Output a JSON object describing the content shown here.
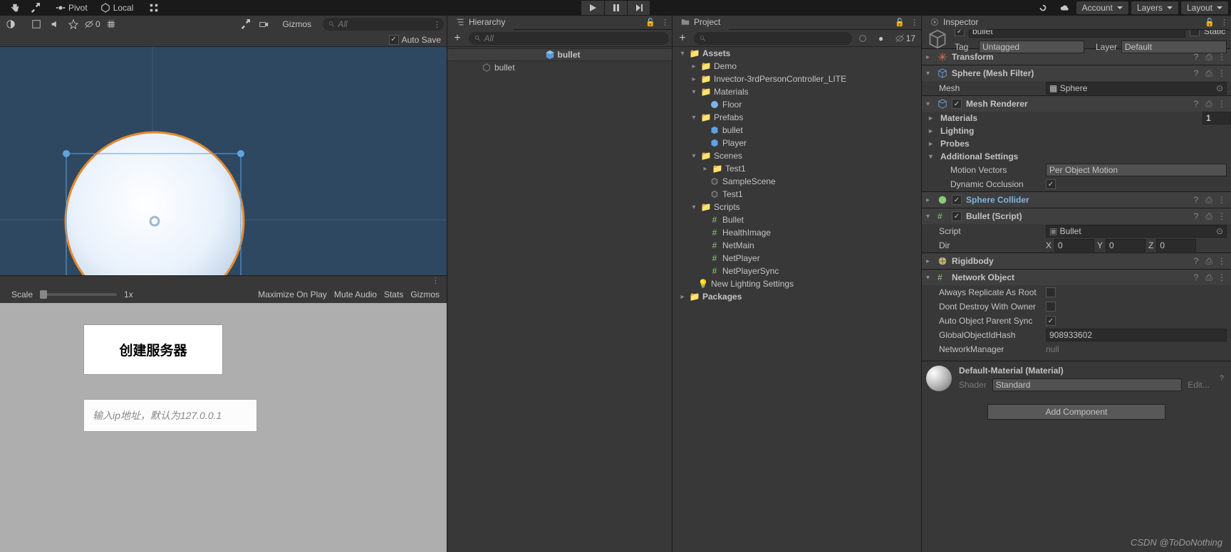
{
  "topbar": {
    "pivot_label": "Pivot",
    "local_label": "Local",
    "account_label": "Account",
    "layers_label": "Layers",
    "layout_label": "Layout"
  },
  "scene": {
    "gizmos_label": "Gizmos",
    "search_placeholder": "All",
    "autosave_label": "Auto Save",
    "shading_value": "0",
    "scale_label": "Scale",
    "scale_value": "1x",
    "maximize_label": "Maximize On Play",
    "mute_label": "Mute Audio",
    "stats_label": "Stats",
    "game_gizmos_label": "Gizmos"
  },
  "hierarchy": {
    "title": "Hierarchy",
    "search_placeholder": "All",
    "root": "bullet",
    "items": [
      "bullet"
    ]
  },
  "project": {
    "title": "Project",
    "search_placeholder": "",
    "vis_count": "17",
    "tree": {
      "assets": "Assets",
      "demo": "Demo",
      "invector": "Invector-3rdPersonController_LITE",
      "materials": "Materials",
      "floor": "Floor",
      "prefabs": "Prefabs",
      "bullet": "bullet",
      "player": "Player",
      "scenes": "Scenes",
      "test1f": "Test1",
      "samplescene": "SampleScene",
      "test1": "Test1",
      "scripts": "Scripts",
      "sc_bullet": "Bullet",
      "sc_health": "HealthImage",
      "sc_netmain": "NetMain",
      "sc_netplayer": "NetPlayer",
      "sc_netplayersync": "NetPlayerSync",
      "lighting": "New Lighting Settings",
      "packages": "Packages"
    }
  },
  "inspector": {
    "title": "Inspector",
    "name": "bullet",
    "static_label": "Static",
    "tag_label": "Tag",
    "tag_value": "Untagged",
    "layer_label": "Layer",
    "layer_value": "Default",
    "comp_transform": "Transform",
    "comp_meshfilter": "Sphere (Mesh Filter)",
    "mesh_label": "Mesh",
    "mesh_value": "Sphere",
    "comp_meshrenderer": "Mesh Renderer",
    "materials_label": "Materials",
    "materials_count": "1",
    "lighting_label": "Lighting",
    "probes_label": "Probes",
    "addl_label": "Additional Settings",
    "motion_label": "Motion Vectors",
    "motion_value": "Per Object Motion",
    "dynocc_label": "Dynamic Occlusion",
    "comp_spherecollider": "Sphere Collider",
    "comp_bulletscript": "Bullet (Script)",
    "script_label": "Script",
    "script_value": "Bullet",
    "dir_label": "Dir",
    "dir_x": "0",
    "dir_y": "0",
    "dir_z": "0",
    "comp_rigidbody": "Rigidbody",
    "comp_netobj": "Network Object",
    "replroot_label": "Always Replicate As Root",
    "dontdestroy_label": "Dont Destroy With Owner",
    "autoparent_label": "Auto Object Parent Sync",
    "hash_label": "GlobalObjectIdHash",
    "hash_value": "908933602",
    "netmgr_label": "NetworkManager",
    "netmgr_value": "null",
    "material_name": "Default-Material (Material)",
    "shader_label": "Shader",
    "shader_value": "Standard",
    "edit_label": "Edit...",
    "addcomp_label": "Add Component"
  },
  "game": {
    "btn_create": "创建服务器",
    "input_placeholder": "输入ip地址，默认为127.0.0.1"
  },
  "watermark": "CSDN @ToDoNothing"
}
